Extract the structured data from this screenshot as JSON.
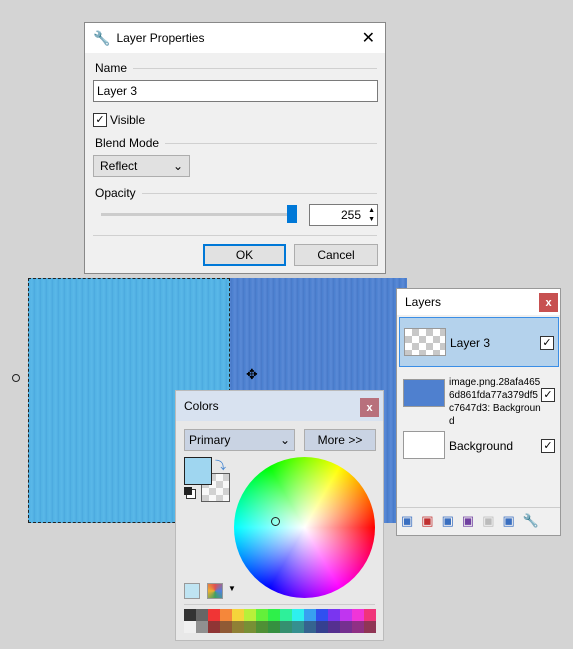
{
  "dialog": {
    "title": "Layer Properties",
    "name_label": "Name",
    "name_value": "Layer 3",
    "visible_label": "Visible",
    "visible_checked": true,
    "blend_label": "Blend Mode",
    "blend_value": "Reflect",
    "opacity_label": "Opacity",
    "opacity_value": "255",
    "opacity_fraction": 1.0,
    "ok": "OK",
    "cancel": "Cancel"
  },
  "layers": {
    "title": "Layers",
    "close": "x",
    "items": [
      {
        "name": "Layer 3",
        "visible": true,
        "selected": true
      },
      {
        "name": "image.png.28afa4656d861fda77a379df5c7647d3: Background",
        "visible": true
      },
      {
        "name": "Background",
        "visible": true
      }
    ],
    "toolbar": [
      "add-layer-icon",
      "delete-layer-icon",
      "duplicate-layer-icon",
      "merge-layer-down-icon",
      "move-layer-up-icon",
      "move-layer-down-icon",
      "layer-properties-icon"
    ]
  },
  "colors": {
    "title": "Colors",
    "close": "x",
    "mode": "Primary",
    "more": "More >>",
    "primary": "#9fd6f0",
    "secondary": "transparent",
    "palette_top": [
      "#333333",
      "#666666",
      "#f03535",
      "#f5873a",
      "#f5d53a",
      "#b8f03a",
      "#63f03a",
      "#2ef04a",
      "#2ef09a",
      "#2ef0ee",
      "#38a0f0",
      "#3050f0",
      "#7a35f0",
      "#c035f0",
      "#f035d8",
      "#f0357a"
    ],
    "palette_bottom": [
      "#f0f0f0",
      "#909090",
      "#903535",
      "#905a35",
      "#908035",
      "#789035",
      "#4f9035",
      "#359040",
      "#359070",
      "#359090",
      "#356490",
      "#354090",
      "#553090",
      "#753090",
      "#903085",
      "#903555"
    ]
  }
}
